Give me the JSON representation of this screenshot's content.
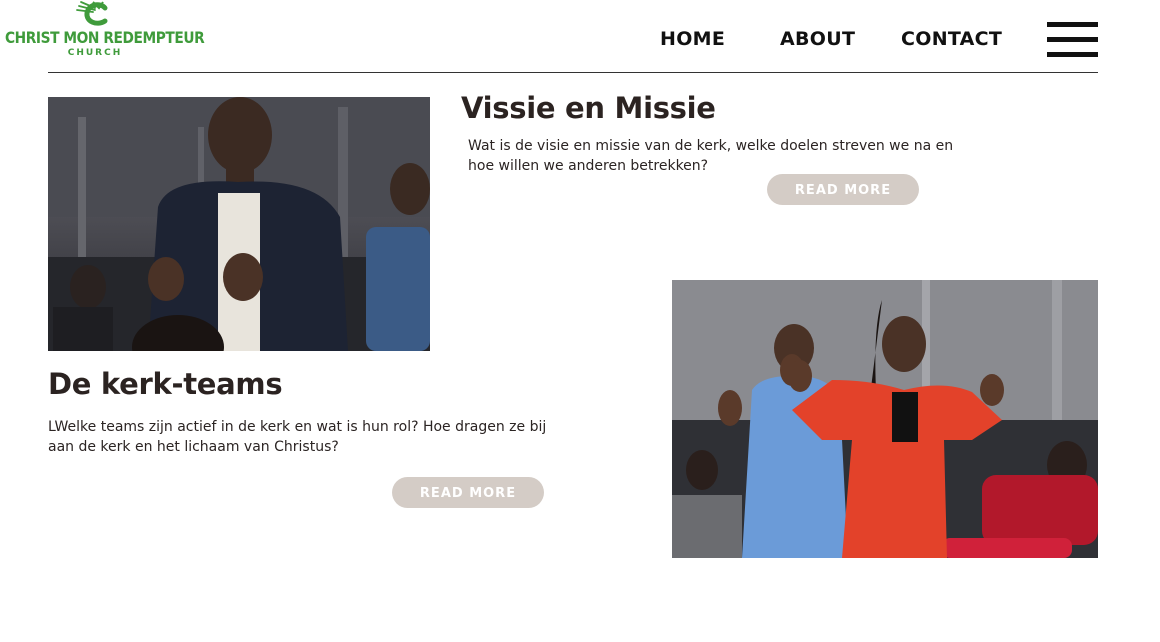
{
  "logo": {
    "name": "CHRIST MON REDEMPTEUR",
    "sub": "CHURCH"
  },
  "nav": {
    "home": "HOME",
    "about": "ABOUT",
    "contact": "CONTACT"
  },
  "section1": {
    "title": "Vissie en Missie",
    "text": "Wat is de visie en missie van de kerk, welke doelen streven we na en hoe willen we anderen betrekken?",
    "button": "READ MORE"
  },
  "section2": {
    "title": "De kerk-teams",
    "text": "LWelke teams zijn actief in de kerk en wat is hun rol? Hoe dragen ze bij aan de kerk en het lichaam van Christus?",
    "button": "READ MORE"
  },
  "colors": {
    "brand": "#3f9b3b",
    "button": "#d4ccc6",
    "heading": "#2b2321"
  }
}
